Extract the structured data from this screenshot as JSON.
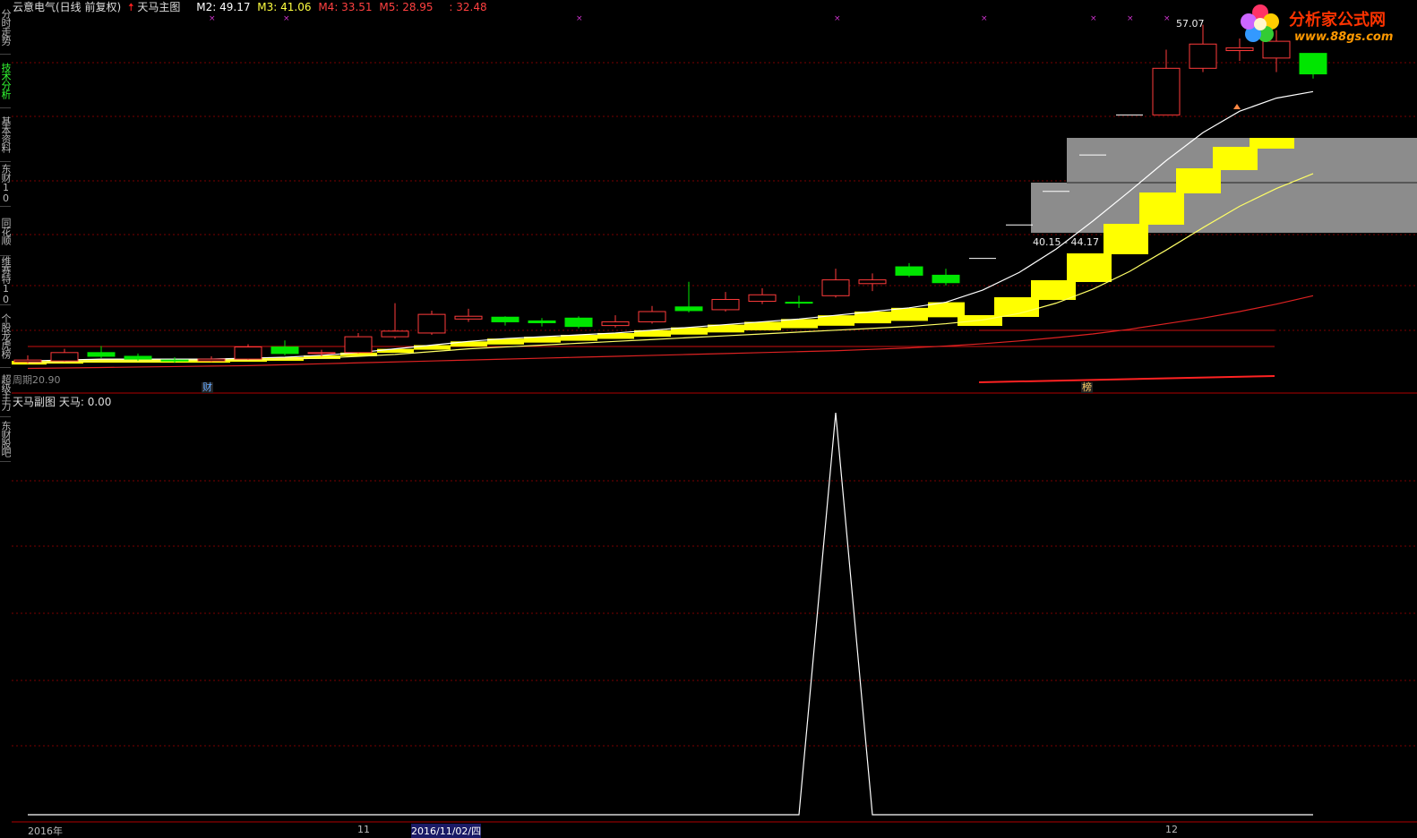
{
  "sidebar": {
    "tabs": [
      {
        "label": "分时走势",
        "active": false
      },
      {
        "label": "技术分析",
        "active": true
      },
      {
        "label": "基本资料",
        "active": false
      },
      {
        "label": "东财10",
        "active": false
      },
      {
        "label": "同花顺",
        "active": false
      },
      {
        "label": "维赛特10",
        "active": false
      },
      {
        "label": "个股龙虎榜",
        "active": false
      },
      {
        "label": "超级主力",
        "active": false
      },
      {
        "label": "东财股吧",
        "active": false
      }
    ]
  },
  "header": {
    "stock_name": "云意电气(日线 前复权)",
    "indicator": "天马主图",
    "m2_label": "M2: 49.17",
    "m3_label": "M3: 41.06",
    "m4_label": "M4: 33.51",
    "m5_label": "M5: 28.95",
    "m6_label": ": 32.48"
  },
  "main_chart": {
    "high_label": "57.07",
    "range_label": "40.15 - 44.17",
    "bottom_left_label": "周期20.90",
    "tag_cai": "财",
    "tag_bang": "榜"
  },
  "sub_chart": {
    "title": "天马副图",
    "value_label": "天马: 0.00"
  },
  "logo": {
    "name": "分析家公式网",
    "url": "www.88gs.com"
  },
  "xaxis": {
    "labels": [
      "2016年",
      "11",
      "2016/11/02/四",
      "12"
    ]
  },
  "colors": {
    "up": "#ff3b3b",
    "down": "#00e600",
    "band": "#ffff00",
    "grid": "#7a0000",
    "zone": "#8c8c8c"
  },
  "chart_data": {
    "type": "candlestick",
    "candles": [
      {
        "o": 20.9,
        "c": 21.1,
        "h": 21.6,
        "l": 20.7
      },
      {
        "o": 21.0,
        "c": 21.9,
        "h": 22.3,
        "l": 20.9
      },
      {
        "o": 21.9,
        "c": 21.5,
        "h": 22.6,
        "l": 21.3
      },
      {
        "o": 21.5,
        "c": 21.2,
        "h": 21.8,
        "l": 21.0
      },
      {
        "o": 21.1,
        "c": 21.0,
        "h": 21.4,
        "l": 20.8
      },
      {
        "o": 21.0,
        "c": 21.2,
        "h": 21.5,
        "l": 20.9
      },
      {
        "o": 21.2,
        "c": 22.5,
        "h": 22.8,
        "l": 21.1
      },
      {
        "o": 22.5,
        "c": 21.8,
        "h": 23.2,
        "l": 21.6
      },
      {
        "o": 21.8,
        "c": 21.9,
        "h": 22.2,
        "l": 21.5
      },
      {
        "o": 21.9,
        "c": 23.6,
        "h": 24.0,
        "l": 21.8
      },
      {
        "o": 23.6,
        "c": 24.2,
        "h": 27.2,
        "l": 23.4
      },
      {
        "o": 24.0,
        "c": 26.0,
        "h": 26.4,
        "l": 23.8
      },
      {
        "o": 25.5,
        "c": 25.8,
        "h": 26.6,
        "l": 25.2
      },
      {
        "o": 25.7,
        "c": 25.2,
        "h": 25.8,
        "l": 24.8
      },
      {
        "o": 25.3,
        "c": 25.1,
        "h": 25.6,
        "l": 24.7
      },
      {
        "o": 25.6,
        "c": 24.7,
        "h": 25.8,
        "l": 24.5
      },
      {
        "o": 24.8,
        "c": 25.2,
        "h": 25.9,
        "l": 24.6
      },
      {
        "o": 25.2,
        "c": 26.3,
        "h": 26.9,
        "l": 25.0
      },
      {
        "o": 26.8,
        "c": 26.4,
        "h": 29.5,
        "l": 26.2
      },
      {
        "o": 26.5,
        "c": 27.6,
        "h": 28.4,
        "l": 26.3
      },
      {
        "o": 27.4,
        "c": 28.1,
        "h": 28.8,
        "l": 27.1
      },
      {
        "o": 27.3,
        "c": 27.2,
        "h": 28.0,
        "l": 26.7
      },
      {
        "o": 28.0,
        "c": 29.7,
        "h": 30.9,
        "l": 27.8
      },
      {
        "o": 29.3,
        "c": 29.7,
        "h": 30.4,
        "l": 28.5
      },
      {
        "o": 31.1,
        "c": 30.2,
        "h": 31.5,
        "l": 30.0
      },
      {
        "o": 30.2,
        "c": 29.4,
        "h": 30.9,
        "l": 29.1
      },
      {
        "o": 32.0,
        "c": 32.0,
        "h": 32.0,
        "l": 32.0
      },
      {
        "o": 35.6,
        "c": 35.6,
        "h": 35.6,
        "l": 35.6
      },
      {
        "o": 39.2,
        "c": 39.2,
        "h": 39.2,
        "l": 39.2
      },
      {
        "o": 43.1,
        "c": 43.1,
        "h": 43.1,
        "l": 43.1
      },
      {
        "o": 47.4,
        "c": 47.4,
        "h": 47.4,
        "l": 47.4
      },
      {
        "o": 47.4,
        "c": 52.4,
        "h": 54.4,
        "l": 47.4
      },
      {
        "o": 52.4,
        "c": 55.0,
        "h": 57.07,
        "l": 52.0
      },
      {
        "o": 54.3,
        "c": 54.6,
        "h": 55.6,
        "l": 53.2
      },
      {
        "o": 53.5,
        "c": 55.3,
        "h": 56.5,
        "l": 52.0
      },
      {
        "o": 54.0,
        "c": 51.8,
        "h": 54.0,
        "l": 51.3
      }
    ],
    "ma_white": [
      21.0,
      21.1,
      21.2,
      21.2,
      21.2,
      21.2,
      21.3,
      21.4,
      21.6,
      21.9,
      22.3,
      22.7,
      23.1,
      23.4,
      23.6,
      23.8,
      24.0,
      24.3,
      24.6,
      24.9,
      25.2,
      25.5,
      25.9,
      26.3,
      26.7,
      27.3,
      28.6,
      30.5,
      33.0,
      36.0,
      39.2,
      42.5,
      45.5,
      47.8,
      49.2,
      49.9
    ],
    "ma_yellow": [
      20.8,
      20.9,
      21.0,
      21.0,
      21.0,
      21.1,
      21.1,
      21.2,
      21.3,
      21.5,
      21.7,
      22.0,
      22.3,
      22.5,
      22.7,
      22.9,
      23.1,
      23.3,
      23.5,
      23.7,
      23.9,
      24.1,
      24.3,
      24.5,
      24.7,
      25.0,
      25.4,
      26.1,
      27.2,
      28.7,
      30.6,
      32.9,
      35.3,
      37.6,
      39.5,
      41.1
    ],
    "ma_red": [
      20.2,
      20.25,
      20.3,
      20.35,
      20.4,
      20.45,
      20.5,
      20.6,
      20.7,
      20.8,
      20.9,
      21.0,
      21.1,
      21.2,
      21.3,
      21.4,
      21.5,
      21.6,
      21.7,
      21.8,
      21.9,
      22.0,
      22.1,
      22.25,
      22.4,
      22.6,
      22.85,
      23.15,
      23.5,
      23.9,
      24.4,
      25.0,
      25.6,
      26.3,
      27.1,
      28.0
    ],
    "sub_values": [
      0,
      0,
      0,
      0,
      0,
      0,
      0,
      0,
      0,
      0,
      0,
      0,
      0,
      0,
      0,
      0,
      0,
      0,
      0,
      0,
      0,
      0,
      1,
      0,
      0,
      0,
      0,
      0,
      0,
      0,
      0,
      0,
      0,
      0,
      0,
      0
    ],
    "ylim": [
      19.0,
      58.0
    ]
  }
}
